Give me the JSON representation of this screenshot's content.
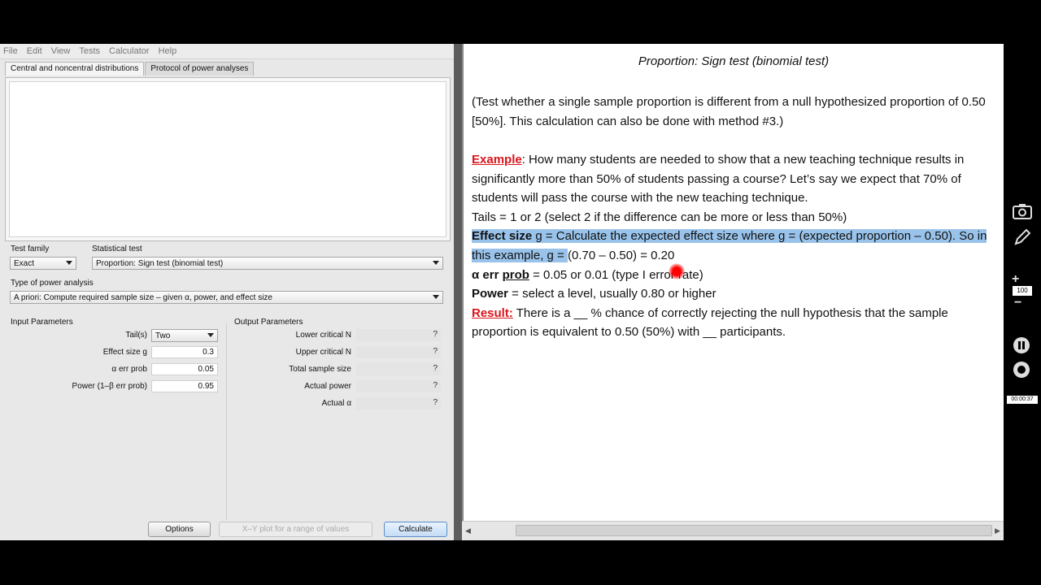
{
  "menu": [
    "File",
    "Edit",
    "View",
    "Tests",
    "Calculator",
    "Help"
  ],
  "tabs": [
    "Central and noncentral distributions",
    "Protocol of power analyses"
  ],
  "test_family": {
    "label": "Test family",
    "value": "Exact"
  },
  "statistical_test": {
    "label": "Statistical test",
    "value": "Proportion: Sign test (binomial test)"
  },
  "power_analysis": {
    "label": "Type of power analysis",
    "value": "A priori: Compute required sample size – given α, power, and effect size"
  },
  "input": {
    "title": "Input Parameters",
    "tails_label": "Tail(s)",
    "tails_value": "Two",
    "effect_label": "Effect size g",
    "effect_value": "0.3",
    "alpha_label": "α err prob",
    "alpha_value": "0.05",
    "power_label": "Power (1–β err prob)",
    "power_value": "0.95"
  },
  "output": {
    "title": "Output Parameters",
    "rows": [
      {
        "label": "Lower critical N",
        "value": "?"
      },
      {
        "label": "Upper critical N",
        "value": "?"
      },
      {
        "label": "Total sample size",
        "value": "?"
      },
      {
        "label": "Actual power",
        "value": "?"
      },
      {
        "label": "Actual α",
        "value": "?"
      }
    ]
  },
  "buttons": {
    "options": "Options",
    "xy": "X–Y plot for a range of values",
    "calculate": "Calculate"
  },
  "doc": {
    "title": "Proportion:  Sign test (binomial test)",
    "intro": "(Test whether a single sample proportion is different from a null hypothesized proportion of 0.50 [50%].  This calculation can also be done with method #3.)",
    "example_label": "Example",
    "example_text": ": How many students are needed to show that a new teaching technique results in significantly more than 50% of students passing a course? Let’s say we expect that 70% of students will pass the course with the new teaching technique.",
    "tails": "Tails = 1 or 2 (select 2 if the difference can be more or less than 50%)",
    "effect_bold": "Effect size",
    "effect_hl": " g = Calculate the expected effect size where g = (expected proportion – 0.50). So in this example, g = ",
    "effect_rest": "(0.70 – 0.50) = 0.20",
    "alpha_bold": "α err ",
    "alpha_ul": "prob",
    "alpha_rest": " = 0.05 or 0.01 (type I error rate)",
    "power_bold": "Power",
    "power_rest": " = select a level, usually 0.80 or higher",
    "result_label": "Result:",
    "result_text": " There is a __ % chance of correctly rejecting the null hypothesis that the sample proportion is equivalent to 0.50 (50%) with __ participants."
  },
  "player": {
    "zoom": "100",
    "time": "00:00:37"
  }
}
